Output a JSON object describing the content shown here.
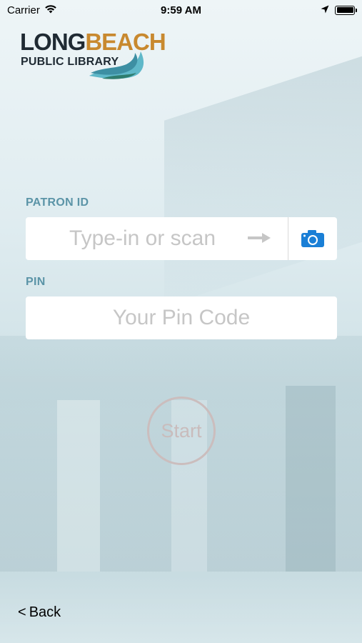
{
  "status_bar": {
    "carrier": "Carrier",
    "time": "9:59 AM"
  },
  "logo": {
    "line1_part1": "LONG",
    "line1_part2": "BEACH",
    "line2": "PUBLIC LIBRARY"
  },
  "form": {
    "patron_id_label": "PATRON ID",
    "patron_id_placeholder": "Type-in or scan",
    "patron_id_value": "",
    "pin_label": "PIN",
    "pin_placeholder": "Your Pin Code",
    "pin_value": ""
  },
  "start_label": "Start",
  "back_label": "Back",
  "colors": {
    "label": "#5b94a7",
    "camera": "#1a7fd6",
    "logo_accent": "#c8892f"
  }
}
